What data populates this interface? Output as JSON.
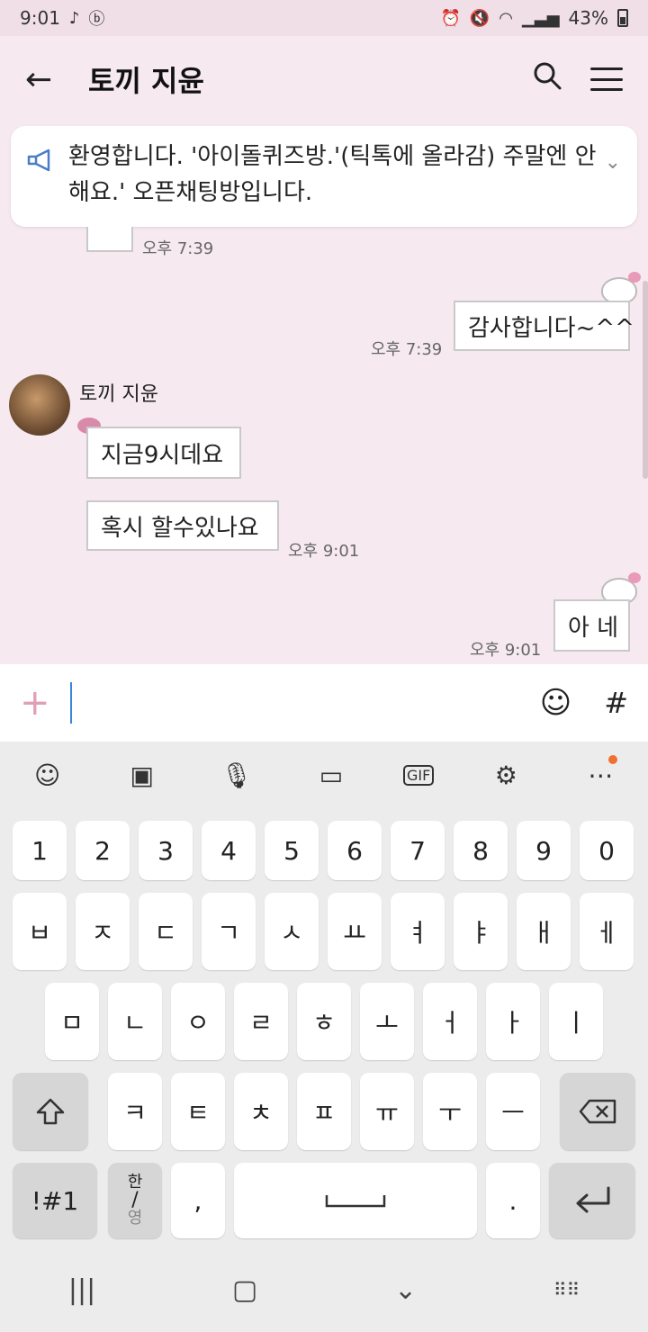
{
  "status": {
    "time": "9:01",
    "battery": "43%"
  },
  "header": {
    "title": "토끼 지윤"
  },
  "notice": {
    "text": "환영합니다. '아이돌퀴즈방.'(틱톡에 올라감) 주말엔 안해요.' 오픈채팅방입니다."
  },
  "messages": [
    {
      "side": "left-partial",
      "time": "오후 7:39"
    },
    {
      "side": "right",
      "text": "감사합니다~^^",
      "time": "오후 7:39"
    },
    {
      "side": "left",
      "sender": "토끼 지윤",
      "text": "지금9시데요"
    },
    {
      "side": "left",
      "text": "혹시 할수있나요",
      "time": "오후 9:01"
    },
    {
      "side": "right",
      "text": "아 네",
      "time": "오후 9:01"
    }
  ],
  "input": {
    "placeholder": ""
  },
  "keyboard": {
    "row1": [
      "1",
      "2",
      "3",
      "4",
      "5",
      "6",
      "7",
      "8",
      "9",
      "0"
    ],
    "row2": [
      "ㅂ",
      "ㅈ",
      "ㄷ",
      "ㄱ",
      "ㅅ",
      "ㅛ",
      "ㅕ",
      "ㅑ",
      "ㅐ",
      "ㅔ"
    ],
    "row3": [
      "ㅁ",
      "ㄴ",
      "ㅇ",
      "ㄹ",
      "ㅎ",
      "ㅗ",
      "ㅓ",
      "ㅏ",
      "ㅣ"
    ],
    "row4": [
      "ㅋ",
      "ㅌ",
      "ㅊ",
      "ㅍ",
      "ㅠ",
      "ㅜ",
      "ㅡ"
    ],
    "symbols": "!#1",
    "lang_top": "한",
    "lang_bottom": "영",
    "comma": ",",
    "period": "."
  },
  "icons": {
    "back": "arrow-left",
    "search": "magnifier",
    "menu": "hamburger",
    "notice": "megaphone",
    "chevron": "chevron-down",
    "plus": "plus",
    "emoji": "smiley",
    "hash": "hash",
    "kb_tools": [
      "emoji",
      "sticker",
      "microphone",
      "clipboard",
      "gif",
      "settings",
      "more"
    ]
  },
  "colors": {
    "background": "#f6e9ef",
    "accent": "#3a86d8",
    "plus": "#e0a0b4"
  }
}
